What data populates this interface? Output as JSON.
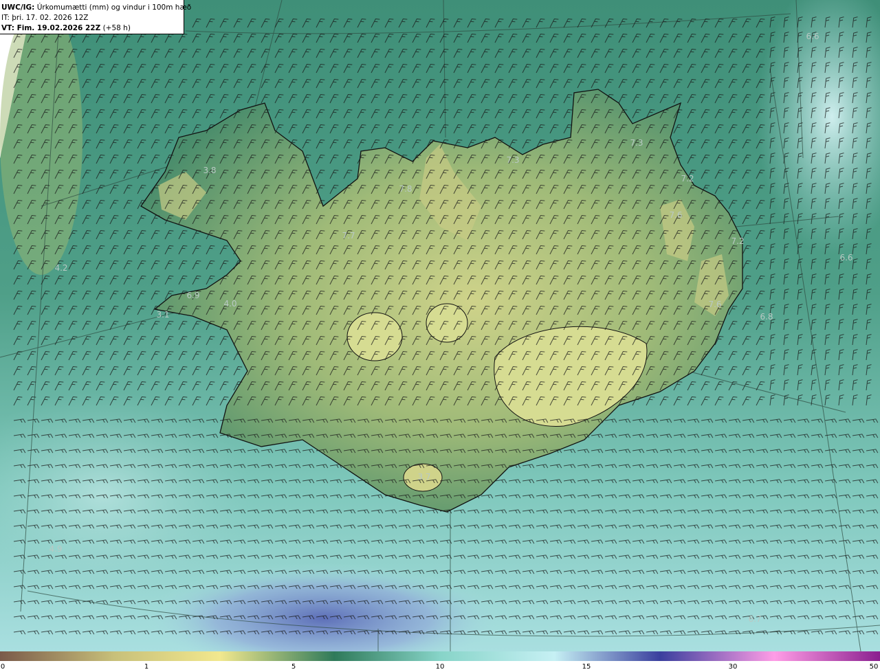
{
  "header": {
    "title_bold": "UWC/IG:",
    "title_rest": "Úrkomumætti (mm) og vindur i 100m hæð",
    "it_line": "IT: þri. 17. 02. 2026 12Z",
    "vt_bold": "VT: Fim. 19.02.2026 22Z",
    "vt_rest": "(+58 h)"
  },
  "map_values": [
    "3.8",
    "4.2",
    "6.9",
    "4.0",
    "3.1",
    "7.8",
    "7.7",
    "7.3",
    "7.3",
    "7.2",
    "7.6",
    "7.2",
    "6.6",
    "7.6",
    "6.8",
    "3.7",
    "4.9",
    "6.7",
    "6.6"
  ],
  "colorbar": {
    "ticks": [
      "0",
      "1",
      "5",
      "10",
      "15",
      "30",
      "50"
    ],
    "colors": [
      "#7a5a4a",
      "#c8c07a",
      "#f2e88e",
      "#2f7a5a",
      "#87d4c8",
      "#c6f0f4",
      "#3a3f9e",
      "#ff9de6",
      "#8a1f8f"
    ]
  },
  "colors": {
    "ocean": "#6bb8a8",
    "land": "#8fb070",
    "coast": "#111111",
    "label": "#b9c9c4"
  }
}
